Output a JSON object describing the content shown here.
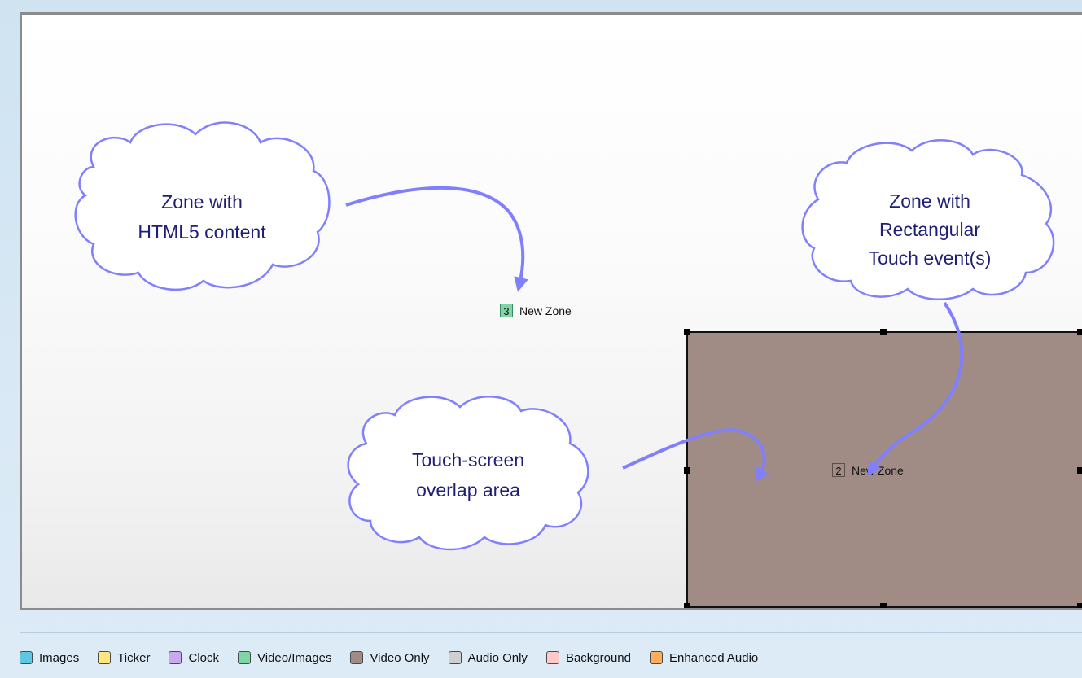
{
  "zones": [
    {
      "number": "3",
      "label": "New Zone",
      "color": "#7ed6a7"
    },
    {
      "number": "2",
      "label": "New Zone",
      "color": "#a08c84"
    }
  ],
  "callouts": {
    "html5": [
      "Zone with",
      "HTML5 content"
    ],
    "touch": [
      "Zone with",
      "Rectangular",
      "Touch event(s)"
    ],
    "overlap": [
      "Touch-screen",
      "overlap area"
    ]
  },
  "callout_color": "#8080ff",
  "legend": [
    {
      "label": "Images",
      "color": "#5fc8e0"
    },
    {
      "label": "Ticker",
      "color": "#ffe680"
    },
    {
      "label": "Clock",
      "color": "#c9a8f0"
    },
    {
      "label": "Video/Images",
      "color": "#7ed6a7"
    },
    {
      "label": "Video Only",
      "color": "#a08c84"
    },
    {
      "label": "Audio Only",
      "color": "#cfcfcf"
    },
    {
      "label": "Background",
      "color": "#ffc9c9"
    },
    {
      "label": "Enhanced Audio",
      "color": "#ffad5c"
    }
  ]
}
